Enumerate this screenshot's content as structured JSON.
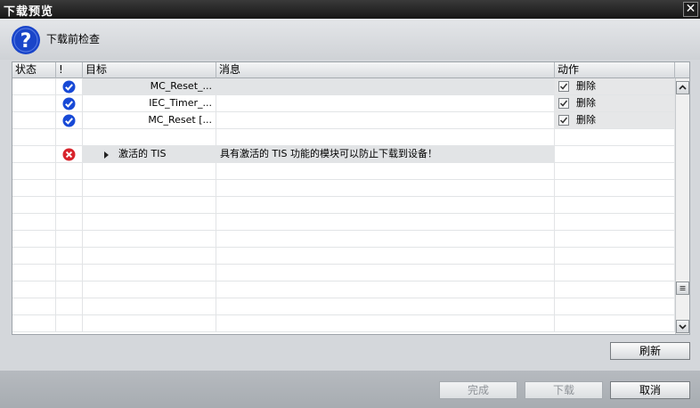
{
  "window": {
    "title": "下载预览",
    "close_glyph": "✕"
  },
  "header": {
    "label": "下载前检查",
    "icon": "help-question-icon",
    "icon_color": "#1a45c9"
  },
  "columns": {
    "status": "状态",
    "flag": "!",
    "target": "目标",
    "message": "消息",
    "action": "动作"
  },
  "rows": [
    {
      "icon": "check-circle-icon",
      "target": "MC_Reset_...",
      "message": "",
      "action": "删除",
      "checked": true
    },
    {
      "icon": "check-circle-icon",
      "target": "IEC_Timer_...",
      "message": "",
      "action": "删除",
      "checked": true
    },
    {
      "icon": "check-circle-icon",
      "target": "MC_Reset [...",
      "message": "",
      "action": "删除",
      "checked": true
    },
    {
      "icon": "",
      "target": "",
      "message": "",
      "action": "",
      "checked": false
    },
    {
      "icon": "error-circle-icon",
      "target": "激活的 TIS",
      "message": "具有激活的 TIS 功能的模块可以防止下载到设备！",
      "action": "",
      "checked": false,
      "expandable": true
    }
  ],
  "buttons": {
    "refresh": "刷新",
    "finish": "完成",
    "download": "下载",
    "cancel": "取消"
  },
  "colors": {
    "check": "#1749d6",
    "error": "#d8242c",
    "titlebar": "#161616"
  }
}
